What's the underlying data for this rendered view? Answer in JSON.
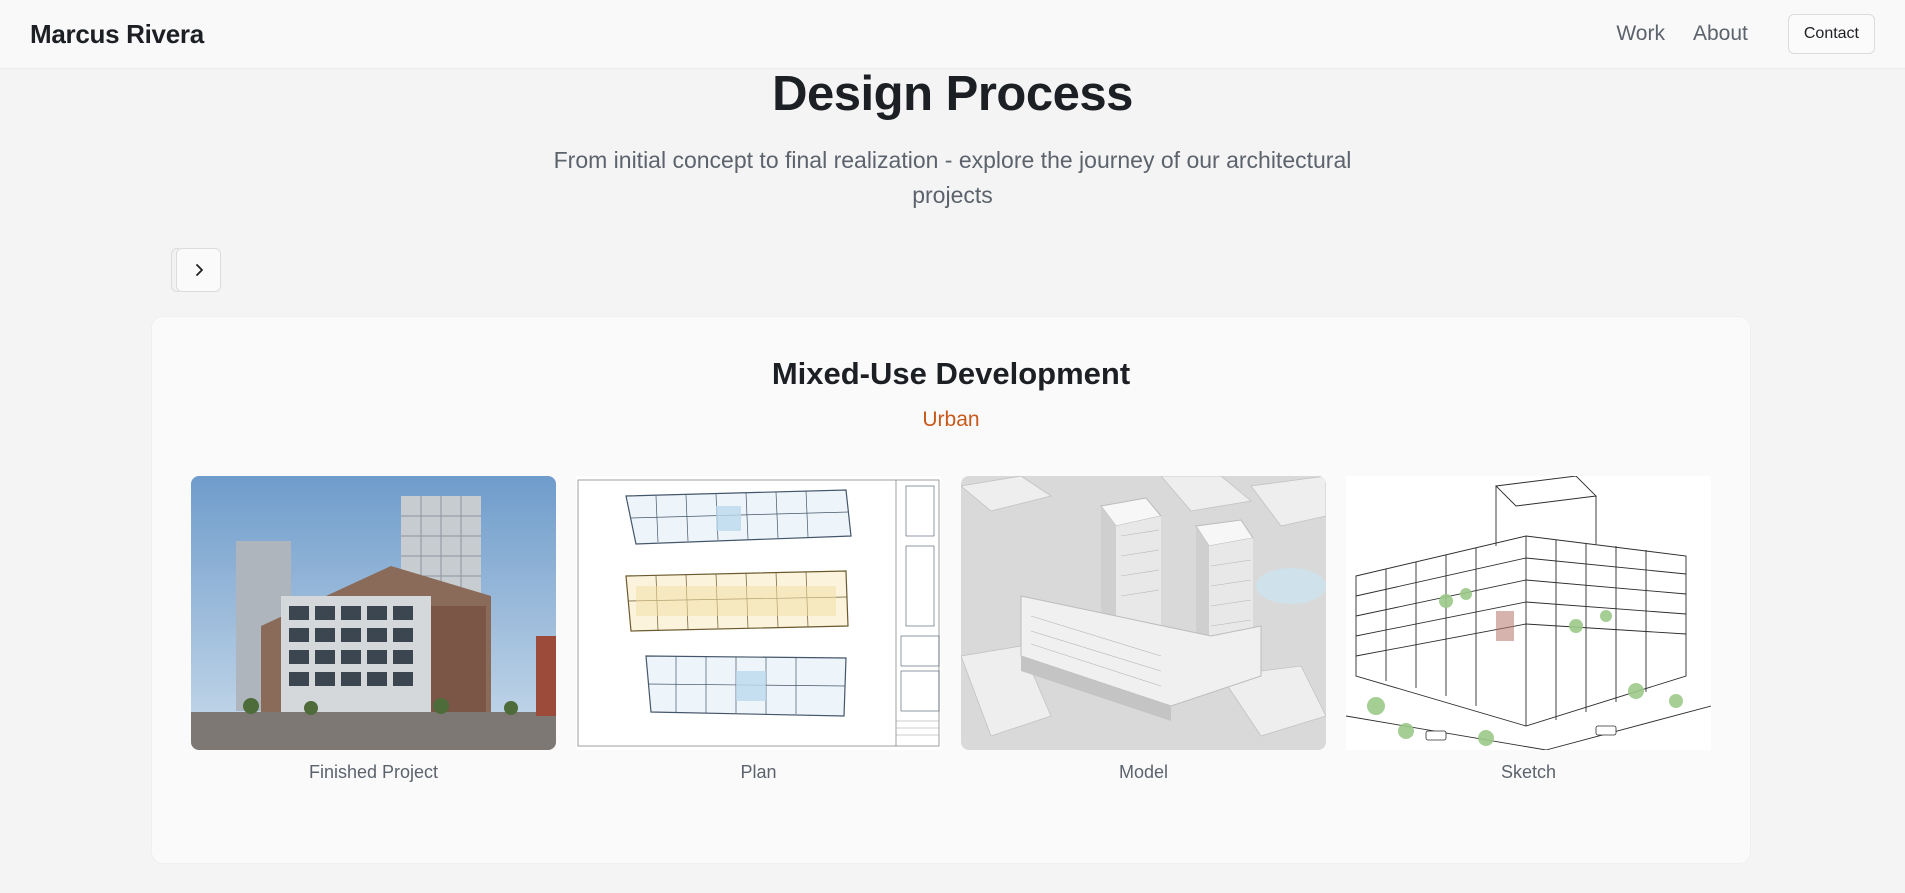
{
  "header": {
    "brand": "Marcus Rivera",
    "nav": [
      "Work",
      "About"
    ],
    "contact_label": "Contact"
  },
  "hero": {
    "title": "Design Process",
    "subtitle": "From initial concept to final realization - explore the journey of our architectural projects"
  },
  "carousel": {
    "next_icon": "chevron-right-icon"
  },
  "project": {
    "title": "Mixed-Use Development",
    "category": "Urban",
    "category_color": "#c75a1a",
    "stages": [
      {
        "label": "Finished Project",
        "image": "photo of finished mixed-use building"
      },
      {
        "label": "Plan",
        "image": "architectural floor plan drawing"
      },
      {
        "label": "Model",
        "image": "white massing model render"
      },
      {
        "label": "Sketch",
        "image": "line sketch of building"
      }
    ]
  }
}
